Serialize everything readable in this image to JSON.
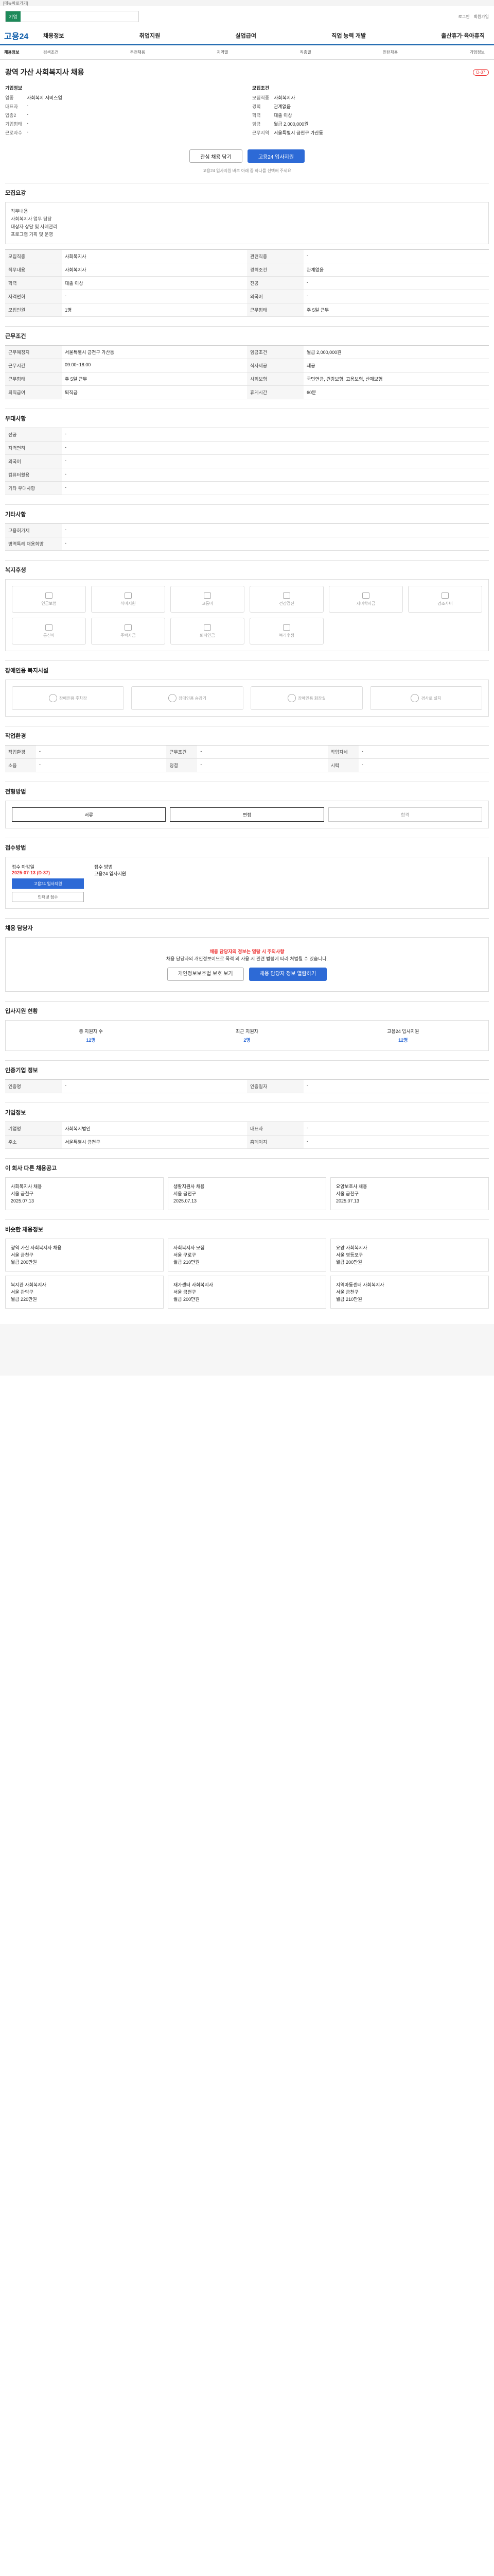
{
  "topbar": {
    "left": "[메뉴바로가기]",
    "right": ""
  },
  "search": {
    "scope": "기업",
    "placeholder": "",
    "links": [
      "로그인",
      "회원가입"
    ]
  },
  "gnb": {
    "logo": "고용24",
    "menus": [
      "채용정보",
      "취업지원",
      "실업급여",
      "직업 능력 개발",
      "출산휴가·육아휴직"
    ]
  },
  "subnav": {
    "first": "채용정보",
    "items": [
      "검색조건",
      "추천채용",
      "지역별",
      "직종별",
      "인턴채용",
      "기업정보"
    ]
  },
  "job": {
    "title": "광역 가산 사회복지사 채용",
    "badge": "D-37",
    "company_hd": "기업정보",
    "company": [
      [
        "업종",
        "사회복지 서비스업"
      ],
      [
        "대표자",
        "-"
      ],
      [
        "업종2",
        "-"
      ],
      [
        "기업형태",
        "-"
      ],
      [
        "근로자수",
        "-"
      ]
    ],
    "cond_hd": "모집조건",
    "cond": [
      [
        "모집직종",
        "사회복지사"
      ],
      [
        "경력",
        "관계없음"
      ],
      [
        "학력",
        "대졸 이상"
      ],
      [
        "임금",
        "월급 2,000,000원"
      ],
      [
        "근무지역",
        "서울특별시 금천구 가산동"
      ]
    ],
    "apply_btn": "관심 채용 담기",
    "apply_btn2": "고용24 입사지원",
    "notice": "고용24 입사지원 바로 아래 중 하나를 선택해 주세요"
  },
  "sections": {
    "s1": "모집요강",
    "s2": "근무조건",
    "s3": "우대사항",
    "s4": "기타사항",
    "s5": "복지후생",
    "s6": "장애인용 복지시설",
    "s7": "작업환경",
    "s8": "전형방법",
    "s9": "접수방법",
    "s10": "채용 담당자",
    "s11": "입사지원 현황",
    "s12": "인증기업 정보",
    "s13": "기업정보",
    "s14": "이 회사 다른 채용공고",
    "s15": "비슷한 채용정보"
  },
  "job_desc": [
    "직무내용",
    "사회복지사 업무 담당",
    "대상자 상담 및 사례관리",
    "프로그램 기획 및 운영"
  ],
  "yoganggrid": [
    [
      "모집직종",
      "사회복지사",
      "관련직종",
      "-"
    ],
    [
      "직무내용",
      "사회복지사",
      "경력조건",
      "관계없음"
    ],
    [
      "학력",
      "대졸 이상",
      "전공",
      "-"
    ],
    [
      "자격면허",
      "-",
      "외국어",
      "-"
    ],
    [
      "모집인원",
      "1명",
      "근무형태",
      "주 5일 근무"
    ]
  ],
  "workgrid": [
    [
      "근무예정지",
      "서울특별시 금천구 가산동",
      "임금조건",
      "월급 2,000,000원"
    ],
    [
      "근무시간",
      "09:00~18:00",
      "식사제공",
      "제공"
    ],
    [
      "근무형태",
      "주 5일 근무",
      "사회보험",
      "국민연금, 건강보험, 고용보험, 산재보험"
    ],
    [
      "퇴직급여",
      "퇴직금",
      "휴게시간",
      "60분"
    ]
  ],
  "prefgrid": [
    [
      "전공",
      "-"
    ],
    [
      "자격면허",
      "-"
    ],
    [
      "외국어",
      "-"
    ],
    [
      "컴퓨터활용",
      "-"
    ],
    [
      "기타 우대사항",
      "-"
    ]
  ],
  "etcgrid": [
    [
      "고용허가제",
      "-"
    ],
    [
      "병역특례 채용희망",
      "-"
    ]
  ],
  "welfare": [
    "연금보험",
    "식비지원",
    "교통비",
    "건강검진",
    "자녀학자금",
    "경조사비",
    "통신비",
    "주택자금",
    "퇴직연금",
    "복리후생"
  ],
  "dis_fac": [
    "장애인용 주차장",
    "장애인용 승강기",
    "장애인용 화장실",
    "경사로 설치"
  ],
  "envgrid": [
    [
      "작업환경",
      "-",
      "근무조건",
      "-",
      "작업자세",
      "-"
    ],
    [
      "소음",
      "-",
      "청결",
      "-",
      "시력",
      "-"
    ]
  ],
  "procs": [
    "서류",
    "면접",
    "합격"
  ],
  "recv": {
    "label": "접수 마감일",
    "date": "2025-07-13 (D-37)",
    "method": "접수 방법",
    "methods": "고용24 입사지원",
    "btn1": "고용24 입사지원",
    "btn2": "인터넷 접수"
  },
  "contact": {
    "line1": "채용 담당자의 정보는 열람 시 주의사항",
    "line2": "채용 담당자의 개인정보이므로 목적 외 사용 시 관련 법령에 따라 처벌될 수 있습니다.",
    "btn1": "개인정보보호법 보호 보기",
    "btn2": "채용 담당자 정보 열람하기"
  },
  "stats": [
    [
      "총 지원자 수",
      "12명"
    ],
    [
      "최근 지원자",
      "2명"
    ],
    [
      "고용24 입사지원",
      "12명"
    ]
  ],
  "cert": [
    [
      "인증명",
      "-",
      "인증일자",
      "-"
    ]
  ],
  "comp": [
    [
      "기업명",
      "사회복지법인",
      "대표자",
      "-"
    ],
    [
      "주소",
      "서울특별시 금천구",
      "홈페이지",
      "-"
    ]
  ],
  "others": [
    [
      "사회복지사 채용",
      "서울 금천구",
      "2025.07.13"
    ],
    [
      "생활지원사 채용",
      "서울 금천구",
      "2025.07.13"
    ],
    [
      "요양보호사 채용",
      "서울 금천구",
      "2025.07.13"
    ]
  ],
  "similar": [
    [
      "광역 가산 사회복지사 채용",
      "서울 금천구",
      "월급 200만원"
    ],
    [
      "사회복지사 모집",
      "서울 구로구",
      "월급 210만원"
    ],
    [
      "요양 사회복지사",
      "서울 영등포구",
      "월급 200만원"
    ],
    [
      "복지관 사회복지사",
      "서울 관악구",
      "월급 220만원"
    ],
    [
      "재가센터 사회복지사",
      "서울 금천구",
      "월급 200만원"
    ],
    [
      "지역아동센터 사회복지사",
      "서울 금천구",
      "월급 210만원"
    ]
  ]
}
